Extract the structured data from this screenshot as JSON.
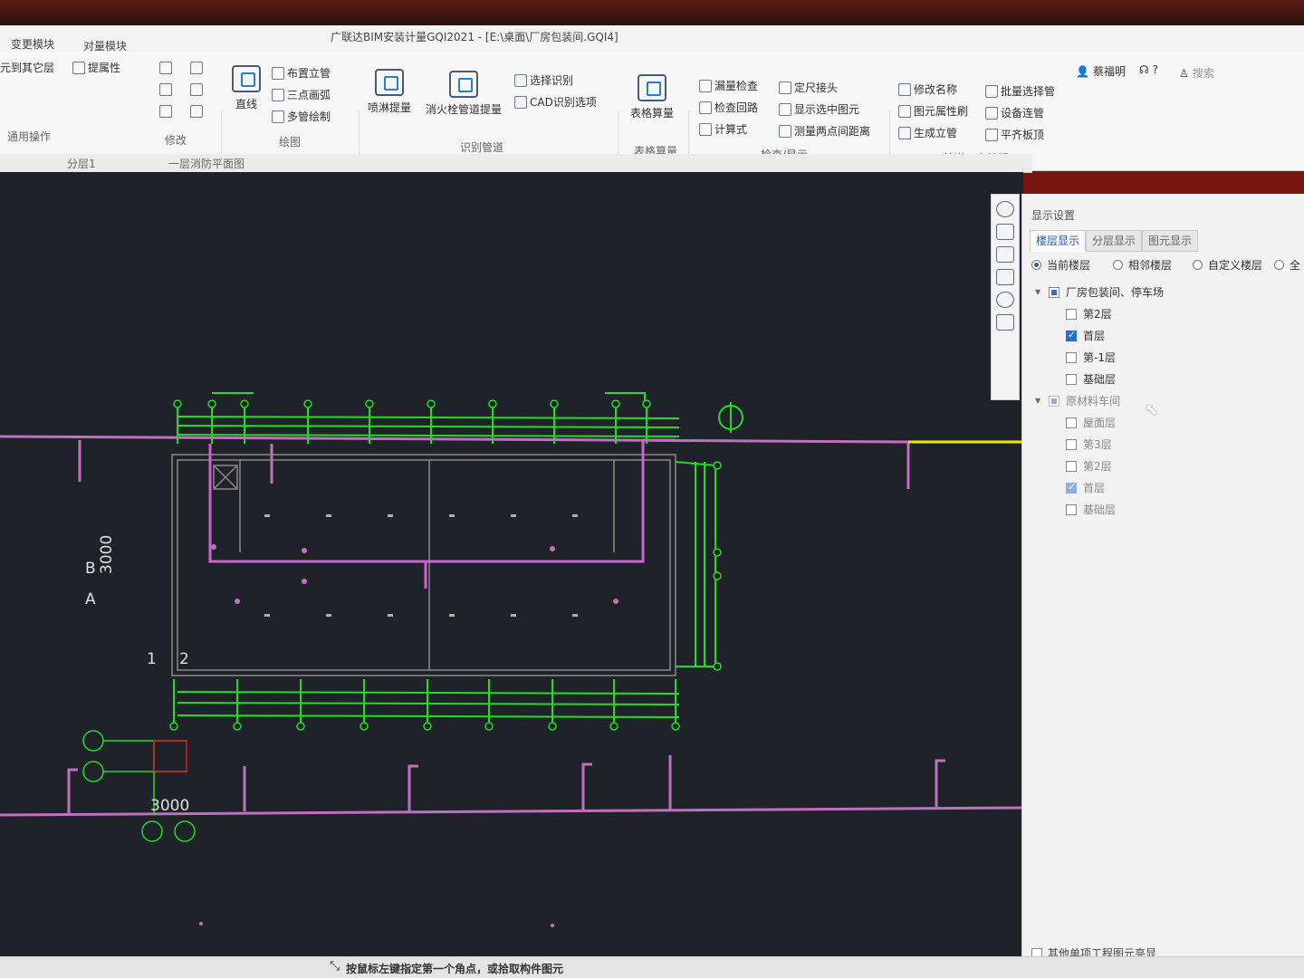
{
  "window": {
    "title": "广联达BIM安装计量GQI2021 - [E:\\桌面\\厂房包装间.GQI4]"
  },
  "top_tabs": [
    "变更模块",
    "对量模块"
  ],
  "ribbon": {
    "common_ops": {
      "copy_to_layer": "元到其它层",
      "extract_props": "提属性",
      "group_label": "通用操作"
    },
    "modify": {
      "group_label": "修改"
    },
    "draw": {
      "line": "直线",
      "vertical_pipe": "布置立管",
      "three_point_arc": "三点画弧",
      "multi_pipe_draw": "多管绘制",
      "group_label": "绘图"
    },
    "identify": {
      "sprinkler_measure": "喷淋提量",
      "hydrant_measure": "消火栓管道提量",
      "select_identify": "选择识别",
      "cad_options": "CAD识别选项",
      "group_label": "识别管道"
    },
    "table": {
      "table_measure": "表格算量",
      "group_label": "表格算量"
    },
    "check": {
      "leak_check": "漏量检查",
      "check_loop": "检查回路",
      "formula": "计算式",
      "set_fitting": "定尺接头",
      "show_selected": "显示选中图元",
      "measure_distance": "测量两点间距离",
      "group_label": "检查/显示"
    },
    "pipe_edit": {
      "rename": "修改名称",
      "prop_brush": "图元属性刷",
      "gen_riser": "生成立管",
      "batch_select": "批量选择管",
      "device_connect": "设备连管",
      "align_slab": "平齐板顶",
      "group_label": "管道二次编辑"
    },
    "user": {
      "name": "蔡福明",
      "help": "?",
      "search": "搜索"
    }
  },
  "layer_bar": {
    "layer": "分层1",
    "drawing": "一层消防平面图"
  },
  "canvas": {
    "axis_labels": {
      "row_b": "B",
      "row_a": "A",
      "col_1": "1",
      "col_2": "2"
    },
    "dim_vertical": "3000",
    "dim_horizontal": "3000"
  },
  "display_panel": {
    "title": "显示设置",
    "tabs": [
      "楼层显示",
      "分层显示",
      "图元显示"
    ],
    "radios": [
      {
        "label": "当前楼层",
        "selected": true
      },
      {
        "label": "相邻楼层",
        "selected": false
      },
      {
        "label": "自定义楼层",
        "selected": false
      },
      {
        "label": "全",
        "selected": false
      }
    ],
    "tree": [
      {
        "label": "厂房包装间、停车场",
        "level": 0,
        "state": "partial"
      },
      {
        "label": "第2层",
        "level": 1,
        "state": "unchecked"
      },
      {
        "label": "首层",
        "level": 1,
        "state": "checked"
      },
      {
        "label": "第-1层",
        "level": 1,
        "state": "unchecked"
      },
      {
        "label": "基础层",
        "level": 1,
        "state": "unchecked"
      },
      {
        "label": "原材料车间",
        "level": 0,
        "state": "partial-dim"
      },
      {
        "label": "屋面层",
        "level": 1,
        "state": "unchecked"
      },
      {
        "label": "第3层",
        "level": 1,
        "state": "unchecked"
      },
      {
        "label": "第2层",
        "level": 1,
        "state": "unchecked"
      },
      {
        "label": "首层",
        "level": 1,
        "state": "checked-dim"
      },
      {
        "label": "基础层",
        "level": 1,
        "state": "unchecked"
      }
    ],
    "footer_checkbox": "其他单项工程图元亮显"
  },
  "status": {
    "message": "按鼠标左键指定第一个角点，或拾取构件图元"
  },
  "colors": {
    "canvas_bg": "#202229",
    "pipe_green": "#22dd22",
    "wall_pink": "#c878c8",
    "accent_yellow": "#e8e800"
  }
}
